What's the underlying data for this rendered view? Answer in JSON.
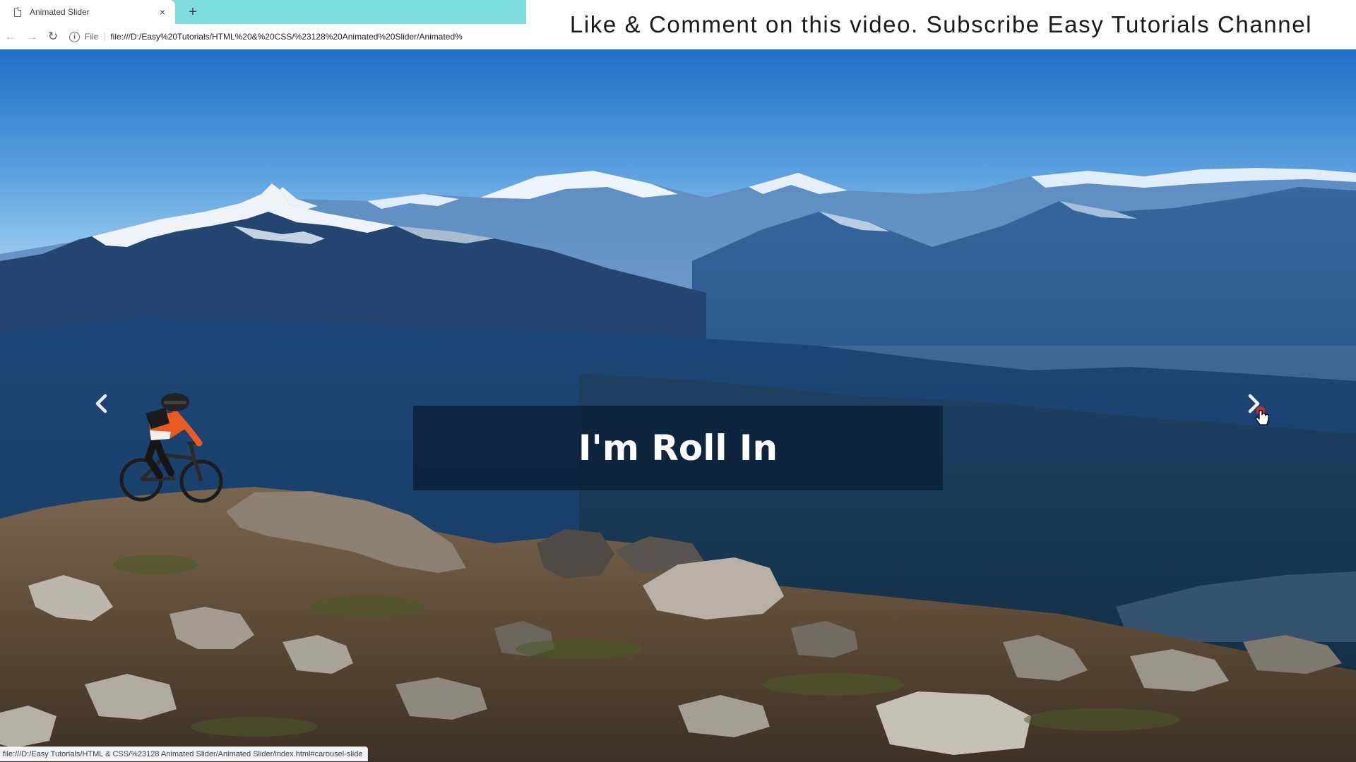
{
  "browser": {
    "tab": {
      "title": "Animated Slider",
      "close_glyph": "×"
    },
    "new_tab_glyph": "+",
    "toolbar": {
      "back_glyph": "←",
      "forward_glyph": "→",
      "reload_glyph": "↻",
      "info_glyph": "i",
      "scheme_label": "File",
      "url": "file:///D:/Easy%20Tutorials/HTML%20&%20CSS/%23128%20Animated%20Slider/Animated%"
    },
    "status_text": "file:///D:/Easy Tutorials/HTML & CSS/%23128 Animated Slider/Animated Slider/index.html#carousel-slide"
  },
  "overlay_caption": "Like & Comment on this video. Subscribe Easy Tutorials Channel",
  "slider": {
    "caption": "I'm Roll In",
    "prev_icon": "chevron-left-icon",
    "next_icon": "chevron-right-icon"
  },
  "colors": {
    "tabstrip": "#7fdcdc",
    "caption_box": "#0c2037",
    "sky_top": "#1f6fc6",
    "sky_bottom": "#cfe6f7"
  }
}
